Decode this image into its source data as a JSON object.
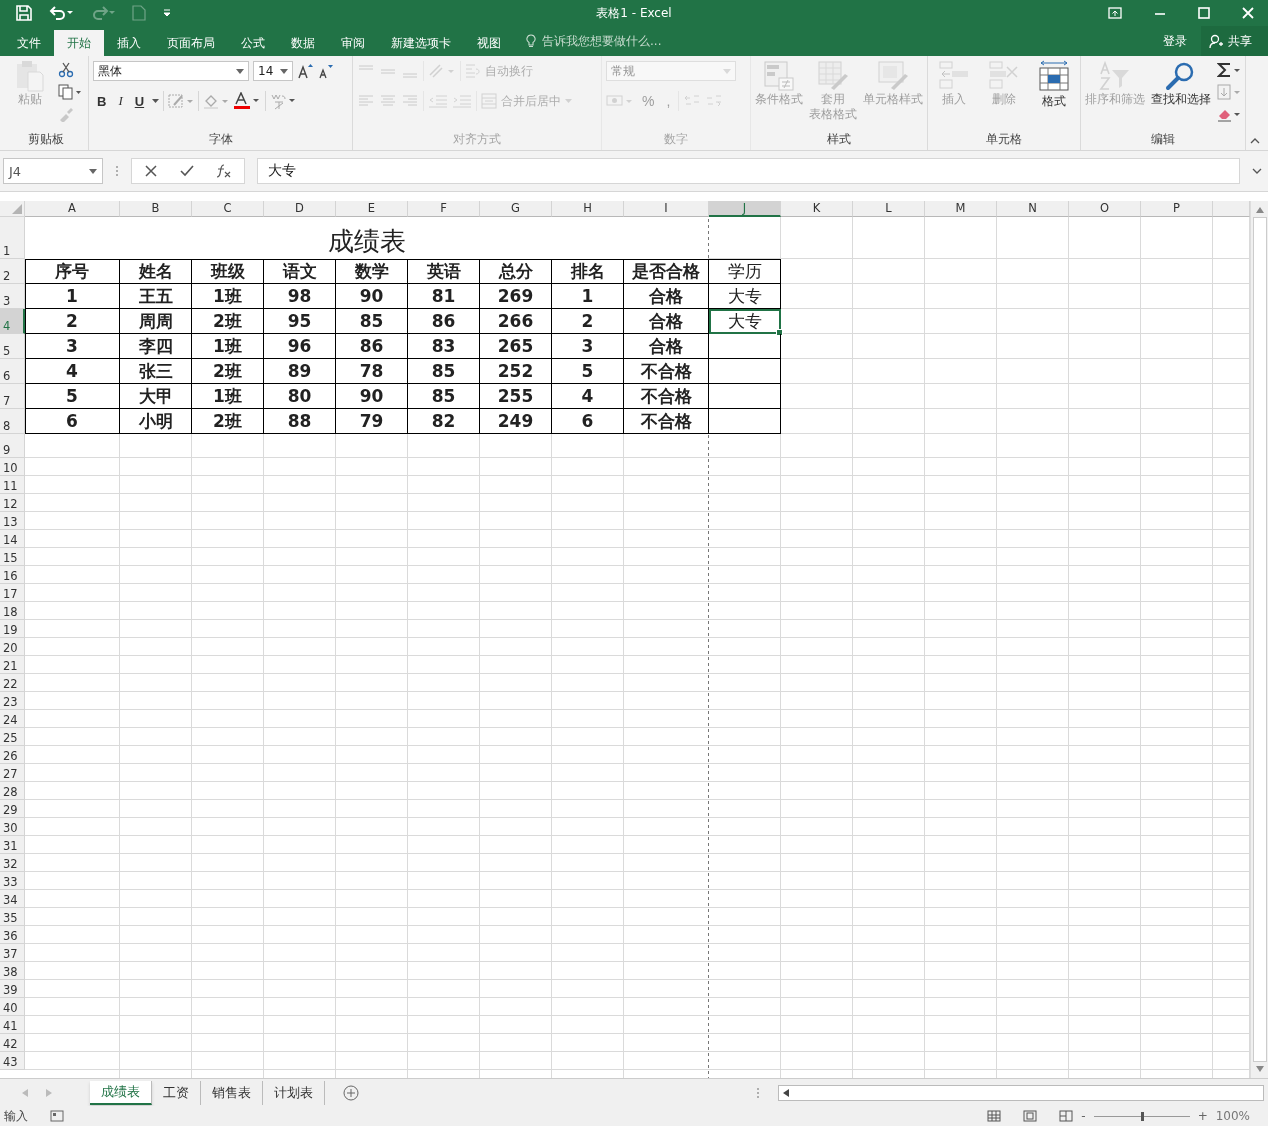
{
  "title_bar": {
    "title": "表格1 - Excel",
    "quick_access": [
      {
        "kind": "save",
        "disabled": false
      },
      {
        "kind": "undo",
        "disabled": false
      },
      {
        "kind": "redo",
        "disabled": true
      },
      {
        "kind": "new",
        "disabled": true
      }
    ]
  },
  "menu": {
    "tabs": [
      {
        "label": "文件",
        "selected": false
      },
      {
        "label": "开始",
        "selected": true
      },
      {
        "label": "插入",
        "selected": false
      },
      {
        "label": "页面布局",
        "selected": false
      },
      {
        "label": "公式",
        "selected": false
      },
      {
        "label": "数据",
        "selected": false
      },
      {
        "label": "审阅",
        "selected": false
      },
      {
        "label": "新建选项卡",
        "selected": false
      },
      {
        "label": "视图",
        "selected": false
      }
    ],
    "tell_me": "告诉我您想要做什么...",
    "sign_in": "登录",
    "share": "共享"
  },
  "ribbon": {
    "clipboard": {
      "label": "剪贴板",
      "paste": "粘贴",
      "paste_disabled": true
    },
    "font": {
      "label": "字体",
      "font_name": "黑体",
      "font_size": "14",
      "bold": "B",
      "italic": "I",
      "underline": "U",
      "disabled": false
    },
    "alignment": {
      "label": "对齐方式",
      "wrap_text": "自动换行",
      "merge_center": "合并后居中",
      "disabled": true
    },
    "number": {
      "label": "数字",
      "format": "常规",
      "percent": "%",
      "comma": ",",
      "disabled": true
    },
    "styles": {
      "label": "样式",
      "items": [
        {
          "kind": "conditional",
          "lines": [
            "条件格式"
          ],
          "disabled": true
        },
        {
          "kind": "table",
          "lines": [
            "套用",
            "表格格式"
          ],
          "disabled": true
        },
        {
          "kind": "cellstyle",
          "lines": [
            "单元格样式"
          ],
          "disabled": true
        }
      ]
    },
    "cells": {
      "label": "单元格",
      "items": [
        {
          "kind": "insert",
          "lines": [
            "插入"
          ],
          "disabled": true
        },
        {
          "kind": "delete",
          "lines": [
            "删除"
          ],
          "disabled": true
        },
        {
          "kind": "format",
          "lines": [
            "格式"
          ],
          "disabled": false
        }
      ]
    },
    "editing": {
      "label": "编辑",
      "items": [
        {
          "kind": "sort",
          "lines": [
            "排序和筛选"
          ],
          "disabled": true
        },
        {
          "kind": "find",
          "lines": [
            "查找和选择"
          ],
          "disabled": false
        }
      ]
    }
  },
  "formula_bar": {
    "name_box": "J4",
    "content": "大专"
  },
  "sheet": {
    "columns": [
      {
        "label": "A",
        "selected": false
      },
      {
        "label": "B",
        "selected": false
      },
      {
        "label": "C",
        "selected": false
      },
      {
        "label": "D",
        "selected": false
      },
      {
        "label": "E",
        "selected": false
      },
      {
        "label": "F",
        "selected": false
      },
      {
        "label": "G",
        "selected": false
      },
      {
        "label": "H",
        "selected": false
      },
      {
        "label": "I",
        "selected": false
      },
      {
        "label": "J",
        "selected": true
      },
      {
        "label": "K",
        "selected": false
      },
      {
        "label": "L",
        "selected": false
      },
      {
        "label": "M",
        "selected": false
      },
      {
        "label": "N",
        "selected": false
      },
      {
        "label": "O",
        "selected": false
      },
      {
        "label": "P",
        "selected": false
      }
    ],
    "title_row": {
      "number": "1",
      "text": "成绩表"
    },
    "table_rows": [
      {
        "number": "2",
        "selected": false,
        "cells": [
          "序号",
          "姓名",
          "班级",
          "语文",
          "数学",
          "英语",
          "总分",
          "排名",
          "是否合格",
          "学历"
        ]
      },
      {
        "number": "3",
        "selected": false,
        "cells": [
          "1",
          "王五",
          "1班",
          "98",
          "90",
          "81",
          "269",
          "1",
          "合格",
          "大专"
        ]
      },
      {
        "number": "4",
        "selected": true,
        "cells": [
          "2",
          "周周",
          "2班",
          "95",
          "85",
          "86",
          "266",
          "2",
          "合格",
          "大专"
        ]
      },
      {
        "number": "5",
        "selected": false,
        "cells": [
          "3",
          "李四",
          "1班",
          "96",
          "86",
          "83",
          "265",
          "3",
          "合格"
        ]
      },
      {
        "number": "6",
        "selected": false,
        "cells": [
          "4",
          "张三",
          "2班",
          "89",
          "78",
          "85",
          "252",
          "5",
          "不合格"
        ]
      },
      {
        "number": "7",
        "selected": false,
        "cells": [
          "5",
          "大甲",
          "1班",
          "80",
          "90",
          "85",
          "255",
          "4",
          "不合格"
        ]
      },
      {
        "number": "8",
        "selected": false,
        "cells": [
          "6",
          "小明",
          "2班",
          "88",
          "79",
          "82",
          "249",
          "6",
          "不合格"
        ]
      }
    ],
    "empty_rows": [
      "9",
      "10",
      "11",
      "12",
      "13",
      "14",
      "15",
      "16",
      "17",
      "18",
      "19",
      "20",
      "21",
      "22",
      "23",
      "24",
      "25",
      "26",
      "27",
      "28",
      "29",
      "30",
      "31",
      "32",
      "33",
      "34",
      "35",
      "36",
      "37",
      "38",
      "39",
      "40",
      "41",
      "42",
      "43"
    ]
  },
  "sheet_tabs": [
    {
      "label": "成绩表",
      "selected": true
    },
    {
      "label": "工资",
      "selected": false
    },
    {
      "label": "销售表",
      "selected": false
    },
    {
      "label": "计划表",
      "selected": false
    }
  ],
  "status_bar": {
    "mode": "输入",
    "zoom_minus": "-",
    "zoom_plus": "+",
    "zoom": "100%",
    "level": 0.5
  }
}
